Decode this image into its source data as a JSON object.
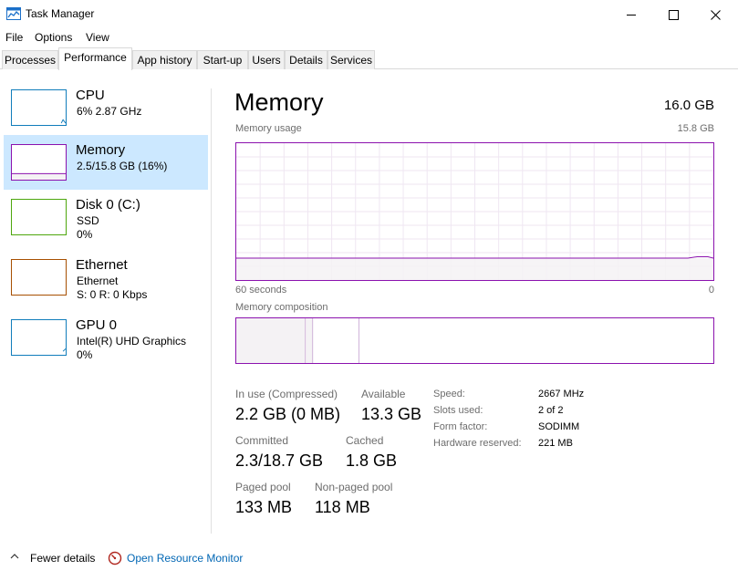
{
  "window": {
    "title": "Task Manager",
    "icon": "task-manager-icon",
    "controls": [
      "minimize-icon",
      "maximize-icon",
      "close-icon"
    ]
  },
  "menu": [
    "File",
    "Options",
    "View"
  ],
  "tabs": [
    "Processes",
    "Performance",
    "App history",
    "Start-up",
    "Users",
    "Details",
    "Services"
  ],
  "active_tab": "Performance",
  "resources": [
    {
      "name": "CPU",
      "line1": "6%  2.87 GHz",
      "line2": "",
      "color": "#117dbb"
    },
    {
      "name": "Memory",
      "line1": "2.5/15.8 GB (16%)",
      "line2": "",
      "color": "#8b12ae"
    },
    {
      "name": "Disk 0 (C:)",
      "line1": "SSD",
      "line2": "0%",
      "color": "#4da60c"
    },
    {
      "name": "Ethernet",
      "line1": "Ethernet",
      "line2": "S: 0 R: 0 Kbps",
      "color": "#a74f01"
    },
    {
      "name": "GPU 0",
      "line1": "Intel(R) UHD Graphics",
      "line2": "0%",
      "color": "#117dbb"
    }
  ],
  "selected_resource": "Memory",
  "memory": {
    "title": "Memory",
    "total": "16.0 GB",
    "usage_label": "Memory usage",
    "usage_max": "15.8 GB",
    "time_left": "60 seconds",
    "time_right": "0",
    "composition_label": "Memory composition",
    "usage_fraction": 0.16,
    "stats": {
      "in_use_label": "In use (Compressed)",
      "in_use_value": "2.2 GB (0 MB)",
      "available_label": "Available",
      "available_value": "13.3 GB",
      "committed_label": "Committed",
      "committed_value": "2.3/18.7 GB",
      "cached_label": "Cached",
      "cached_value": "1.8 GB",
      "paged_label": "Paged pool",
      "paged_value": "133 MB",
      "nonpaged_label": "Non-paged pool",
      "nonpaged_value": "118 MB"
    },
    "specs": {
      "speed_label": "Speed:",
      "speed_value": "2667 MHz",
      "slots_label": "Slots used:",
      "slots_value": "2 of 2",
      "form_label": "Form factor:",
      "form_value": "SODIMM",
      "reserved_label": "Hardware reserved:",
      "reserved_value": "221 MB"
    }
  },
  "footer": {
    "fewer_details": "Fewer details",
    "open_monitor": "Open Resource Monitor"
  },
  "colors": {
    "memory_accent": "#8b12ae",
    "memory_fill": "#f4f2f4",
    "selected_bg": "#cce8ff",
    "link": "#0066b4"
  }
}
